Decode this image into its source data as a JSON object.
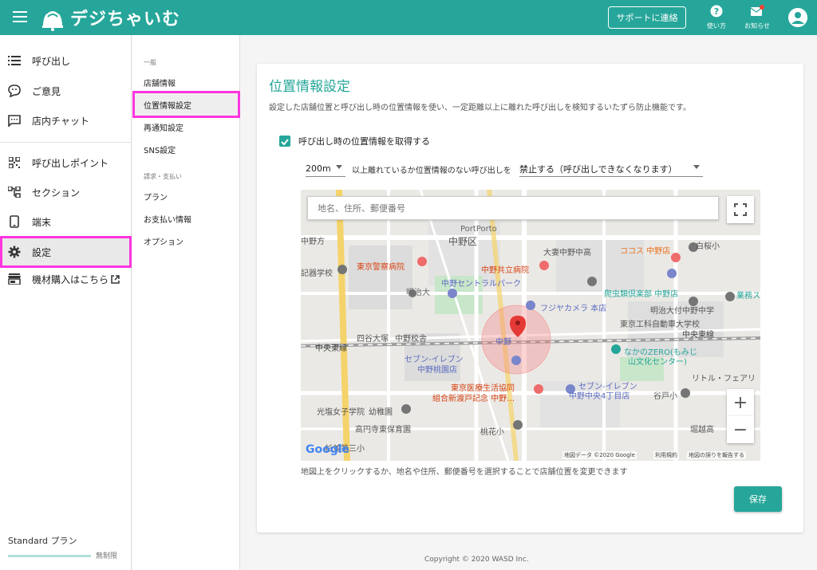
{
  "header": {
    "logo_text": "デジちゃいむ",
    "support_label": "サポートに連絡",
    "help_label": "使い方",
    "notify_label": "お知らせ",
    "brand_color": "#26a69a"
  },
  "sidebar": {
    "items": [
      {
        "label": "呼び出し",
        "icon": "list-icon"
      },
      {
        "label": "ご意見",
        "icon": "feedback-icon"
      },
      {
        "label": "店内チャット",
        "icon": "chat-icon"
      },
      {
        "label": "呼び出しポイント",
        "icon": "qr-code-icon"
      },
      {
        "label": "セクション",
        "icon": "section-icon"
      },
      {
        "label": "端末",
        "icon": "device-icon"
      },
      {
        "label": "設定",
        "icon": "gear-icon"
      },
      {
        "label": "機材購入はこちら",
        "icon": "store-icon"
      }
    ],
    "plan_label": "Standard プラン",
    "plan_limit": "無制限"
  },
  "subnav": {
    "group1": "一般",
    "items1": [
      "店舗情報",
      "位置情報設定",
      "再通知設定",
      "SNS設定"
    ],
    "group2": "請求・支払い",
    "items2": [
      "プラン",
      "お支払い情報",
      "オプション"
    ]
  },
  "main": {
    "title": "位置情報設定",
    "description": "設定した店舗位置と呼び出し時の位置情報を使い、一定距離以上に離れた呼び出しを検知するいたずら防止機能です。",
    "checkbox_label": "呼び出し時の位置情報を取得する",
    "distance_value": "200m",
    "distance_label": "以上離れているか位置情報のない呼び出しを",
    "action_value": "禁止する（呼び出しできなくなります）",
    "map_placeholder": "地名、住所、郵便番号",
    "map_hint": "地図上をクリックするか、地名や住所、郵便番号を選択することで店舗位置を変更できます",
    "save_label": "保存"
  },
  "map": {
    "labels": {
      "nakano_ku": "中野区",
      "police_hospital": "東京警察病院",
      "kyoritsu": "中野共立病院",
      "central_park": "中野セントラルパーク",
      "meiji_univ": "明治大",
      "fujiya": "フジヤカメラ 本店",
      "seven1": "セブン-イレブン",
      "seven1b": "中野桃園店",
      "iryo1": "東京医療生活協同",
      "iryo2": "組合新渡戸記念 中野…",
      "seven2": "セブン-イレブン",
      "seven2b": "中野中央4丁目店",
      "nakano_zero": "なかのZERO(もみじ",
      "nakano_zero2": "山文化センター)",
      "chuo_line": "中央東線",
      "chuo_line2": "中央東線",
      "yotsuya": "四谷大塚",
      "nakano_kosha": "中野校舎",
      "nakano_st": "中野",
      "kouka": "東京工科自動車大学校",
      "meiji_ohashi": "明治大付中野中学",
      "cocos": "ココス 中野店",
      "otsuma": "大妻中野中高",
      "reptile": "爬虫類倶楽部 中野店",
      "mitsuwa": "光塩女子学院",
      "youchien": "幼稚園",
      "koen": "高円寺東保育園",
      "momo": "桃花小",
      "portporto": "PortPorto",
      "shiraishi": "白桜小",
      "gyomu": "業務ス",
      "little": "リトル・フェアリ",
      "tanimo": "谷戸小",
      "horikoshi": "堀越高",
      "suginami": "杉並第三小",
      "nakanohon": "中野方",
      "kigi": "記器学校"
    },
    "attribution": [
      "地図データ ©2020 Google",
      "利用規約",
      "地図の誤りを報告する"
    ],
    "logo_text": "Google"
  },
  "footer": {
    "copyright": "Copyright © 2020 WASD Inc."
  }
}
